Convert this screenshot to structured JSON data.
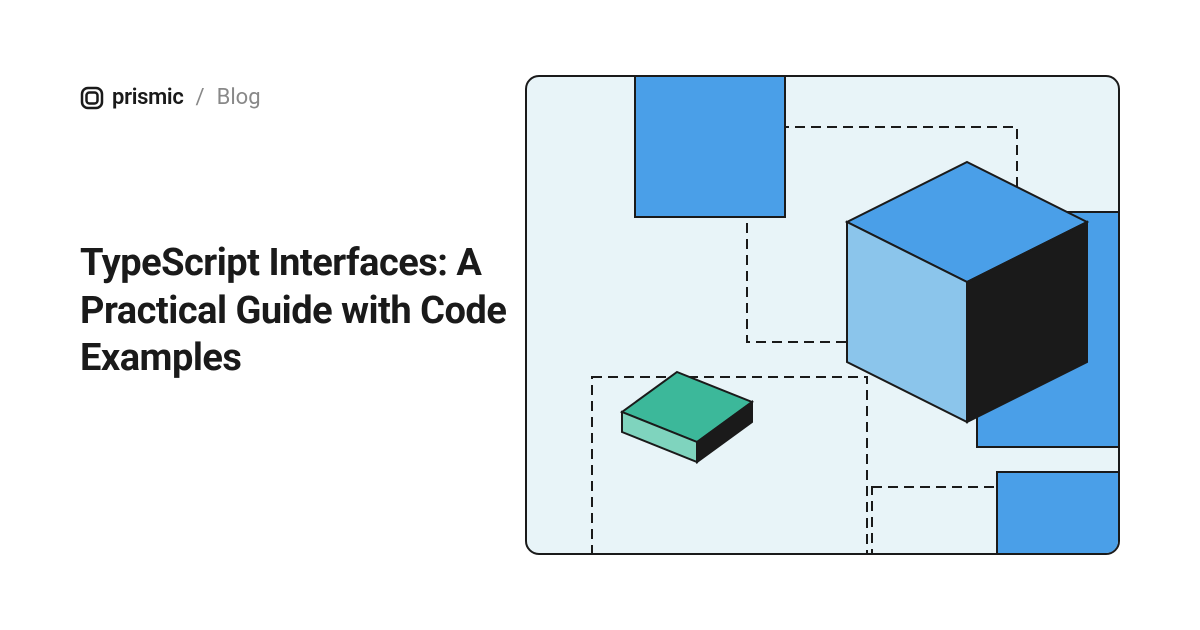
{
  "header": {
    "brand": "prismic",
    "separator": "/",
    "section": "Blog"
  },
  "title": "TypeScript Interfaces: A Practical Guide with Code Examples",
  "colors": {
    "background": "#ffffff",
    "illustration_bg": "#e8f4f8",
    "blue_primary": "#4a9fe8",
    "blue_light": "#8bc5eb",
    "teal": "#3cb89a",
    "teal_light": "#7fd4be",
    "black": "#1a1a1a"
  }
}
